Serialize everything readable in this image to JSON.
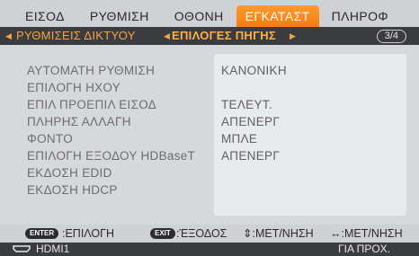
{
  "tabs": [
    {
      "label": "ΕΙΣΟΔ",
      "active": false
    },
    {
      "label": "ΡΥΘΜΙΣΗ",
      "active": false
    },
    {
      "label": "ΟΘΟΝΗ",
      "active": false
    },
    {
      "label": "ΕΓΚΑΤΑΣΤ",
      "active": true
    },
    {
      "label": "ΠΛΗΡΟΦ",
      "active": false
    }
  ],
  "breadcrumb": {
    "left_arrow": "◀",
    "section": "ΡΥΘΜΙΣΕΙΣ ΔΙΚΤΥΟΥ",
    "separator_arrow": "◀",
    "current": "ΕΠΙΛΟΓΕΣ ΠΗΓΗΣ",
    "right_arrow": "▶",
    "page": "3/4"
  },
  "menu": {
    "rows": [
      {
        "label": "ΑΥΤΟΜΑΤΗ ΡΥΘΜΙΣΗ",
        "value": "ΚΑΝΟΝΙΚΗ"
      },
      {
        "label": "ΕΠΙΛΟΓΗ ΗΧΟΥ",
        "value": ""
      },
      {
        "label": "ΕΠΙΛ ΠΡΟΕΠΙΛ ΕΙΣΟΔ",
        "value": "ΤΕΛΕΥΤ."
      },
      {
        "label": "ΠΛΗΡΗΣ ΑΛΛΑΓΗ",
        "value": "ΑΠΕΝΕΡΓ"
      },
      {
        "label": "ΦΟΝΤΟ",
        "value": "ΜΠΛΕ"
      },
      {
        "label": "ΕΠΙΛΟΓΗ ΕΞΟΔΟΥ HDBaseT",
        "value": "ΑΠΕΝΕΡΓ"
      },
      {
        "label": "ΕΚΔΟΣΗ EDID",
        "value": ""
      },
      {
        "label": "ΕΚΔΟΣΗ HDCP",
        "value": ""
      }
    ]
  },
  "help": {
    "enter_key": "ENTER",
    "enter_text": ":ΕΠΙΛΟΓΗ",
    "exit_key": "EXIT",
    "exit_text": ":ΈΞΟΔΟΣ",
    "updown_text": "⇕:ΜΕΤ/ΝΗΣΗ",
    "leftright_text": "↔:ΜΕΤ/ΝΗΣΗ"
  },
  "status": {
    "source": "HDMI1",
    "info": "ΓΙΑ ΠΡΟΧ."
  },
  "colors": {
    "accent": "#f57d10",
    "breadcrumb_text": "#f6a345",
    "background": "#d7d8dc"
  }
}
